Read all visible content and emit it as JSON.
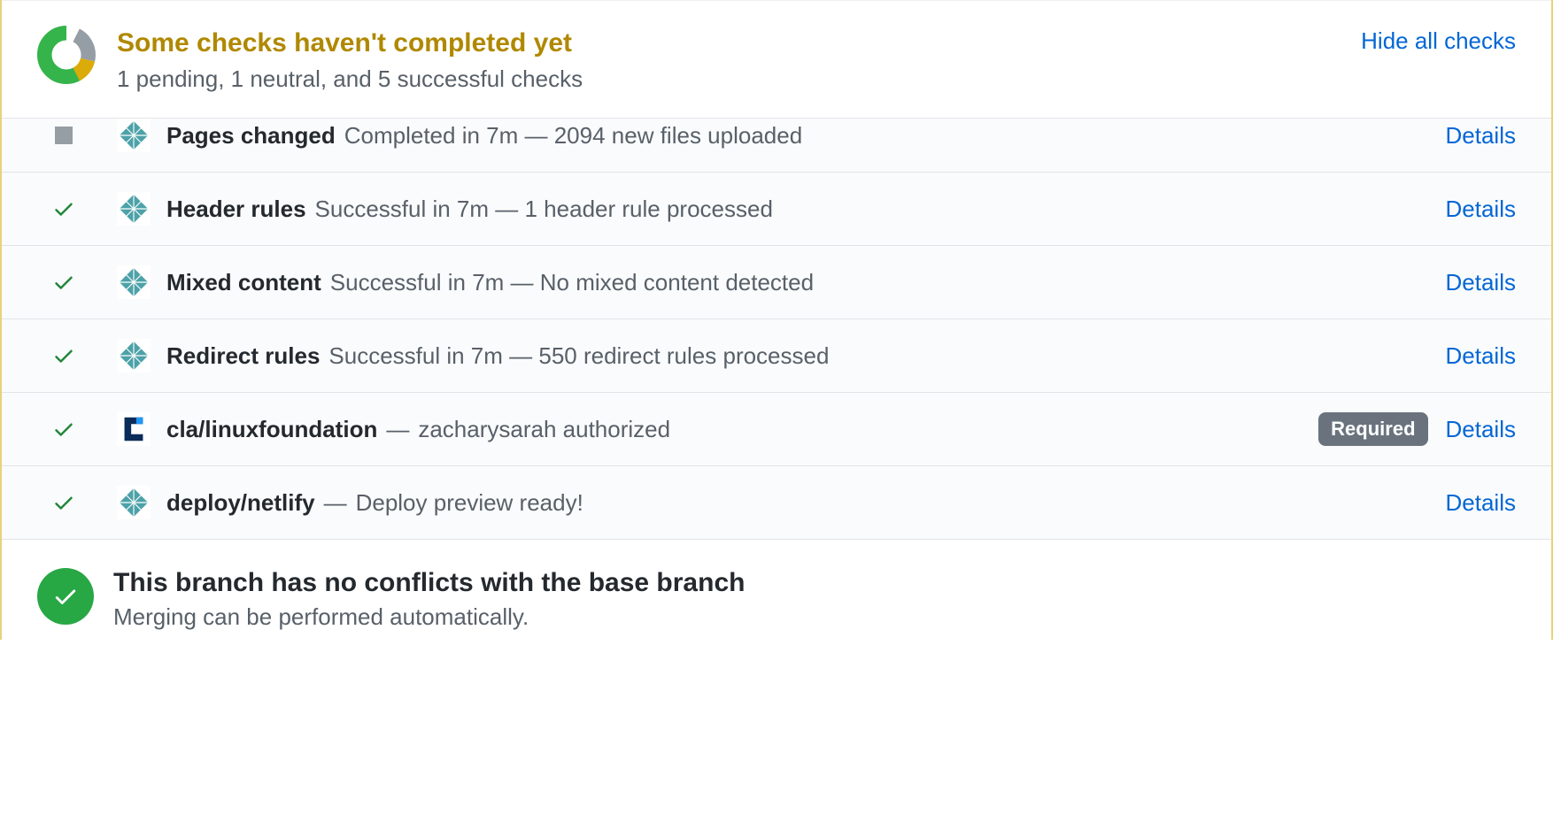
{
  "header": {
    "title": "Some checks haven't completed yet",
    "subtitle": "1 pending, 1 neutral, and 5 successful checks",
    "hide_link": "Hide all checks"
  },
  "checks": [
    {
      "status": "neutral",
      "avatar": "netlify",
      "name": "Pages changed",
      "sep": "",
      "desc": "Completed in 7m — 2094 new files uploaded",
      "details": "Details",
      "required": false,
      "partial_top": true
    },
    {
      "status": "success",
      "avatar": "netlify",
      "name": "Header rules",
      "sep": "",
      "desc": "Successful in 7m — 1 header rule processed",
      "details": "Details",
      "required": false,
      "partial_top": false
    },
    {
      "status": "success",
      "avatar": "netlify",
      "name": "Mixed content",
      "sep": "",
      "desc": "Successful in 7m — No mixed content detected",
      "details": "Details",
      "required": false,
      "partial_top": false
    },
    {
      "status": "success",
      "avatar": "netlify",
      "name": "Redirect rules",
      "sep": "",
      "desc": "Successful in 7m — 550 redirect rules processed",
      "details": "Details",
      "required": false,
      "partial_top": false
    },
    {
      "status": "success",
      "avatar": "lf",
      "name": "cla/linuxfoundation",
      "sep": " — ",
      "desc": "zacharysarah authorized",
      "details": "Details",
      "required": true,
      "partial_top": false
    },
    {
      "status": "success",
      "avatar": "netlify",
      "name": "deploy/netlify",
      "sep": " — ",
      "desc": "Deploy preview ready!",
      "details": "Details",
      "required": false,
      "partial_top": false
    }
  ],
  "required_label": "Required",
  "merge": {
    "title": "This branch has no conflicts with the base branch",
    "subtitle": "Merging can be performed automatically."
  },
  "colors": {
    "pending": "#b08800",
    "success": "#28a745",
    "link": "#0366d6",
    "muted": "#586069"
  }
}
